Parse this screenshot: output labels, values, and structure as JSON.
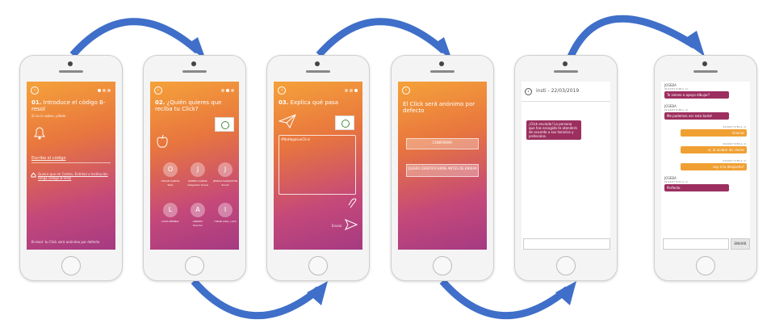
{
  "colors": {
    "arrow": "#3f6fc9",
    "gradient_top": "#f5a23a",
    "gradient_bottom": "#a53a82",
    "bubble_purple": "#9c2f5f",
    "bubble_orange": "#f0a033"
  },
  "screen1": {
    "step_num": "01.",
    "title": "Introduce el código B-resol",
    "subtitle": "Si no lo sabes, pídelo",
    "icon": "bell-icon",
    "code_label": "Escribe el código",
    "link_text": "Quiero que mi Centro, Entidad o Institución tenga código B-resol",
    "footer": "B-resol- tu Click será anónimo por defecto"
  },
  "screen2": {
    "step_num": "02.",
    "title": "¿Quién quieres que reciba tu Click?",
    "icon": "apple-icon",
    "recipients": [
      {
        "initial": "O",
        "name": "OSCAR GARCÍA",
        "role": "Tutor"
      },
      {
        "initial": "J",
        "name": "JOSEBA GARCÍA",
        "role": "Integrador Social"
      },
      {
        "initial": "J",
        "name": "JESSICA SANJUSTÓN",
        "role": "Social"
      },
      {
        "initial": "L",
        "name": "LUCÍA BERNAL",
        "role": ""
      },
      {
        "initial": "A",
        "name": "ANDREA",
        "role": "Director"
      },
      {
        "initial": "I",
        "name": "ITZIAR (NIA) | ACS",
        "role": ""
      }
    ]
  },
  "screen3": {
    "step_num": "03.",
    "title": "Explica qué pasa",
    "icon": "paper-plane-icon",
    "hashtag": "#NoHagasunClick",
    "send_label": "Enviar"
  },
  "screen4": {
    "title": "El Click será anónimo por defecto",
    "confirm_label": "CONFIRMAR",
    "identify_label": "QUIERO IDENTIFICARME ANTES DE ENVIAR"
  },
  "screen5": {
    "header": "insti - 22/03/2019",
    "message": "¡Click enviado! La persona que has escogido te atenderá de acuerdo a sus horarios y protocolos."
  },
  "screen6": {
    "messages": [
      {
        "side": "in",
        "name": "JOSEBA",
        "time": "21/12/17 9:48 a. m.",
        "text": "Te vienes a apoyo dibujar?"
      },
      {
        "side": "in",
        "name": "JOSEBA",
        "time": "21/12/17 9:48 a. m.",
        "text": "Me podemos ver esta tarde!"
      },
      {
        "side": "out",
        "time": "21/12/17 9:50 a. m.",
        "text": "Gracias"
      },
      {
        "side": "out",
        "time": "21/12/17 9:50 a. m.",
        "text": "sí, al acabar las clases"
      },
      {
        "side": "out",
        "time": "21/12/17 9:50 a. m.",
        "text": "voy a tu despacho?"
      },
      {
        "side": "in",
        "name": "JOSEBA",
        "time": "21/12/17 9:51 a. m.",
        "text": "Perfecto"
      }
    ],
    "send_label": "ENVIAR"
  }
}
